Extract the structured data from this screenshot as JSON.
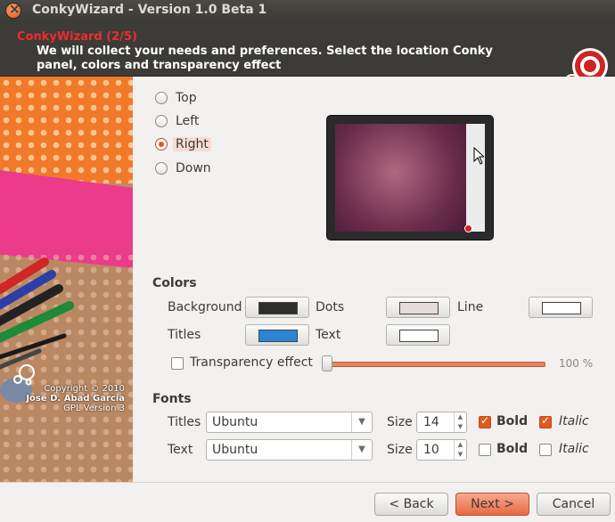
{
  "window": {
    "title": "ConkyWizard - Version 1.0 Beta 1"
  },
  "header": {
    "step": "ConkyWizard (2/5)",
    "description": "We will collect your needs and preferences. Select the location Conky panel, colors and transparency effect"
  },
  "sidebar": {
    "credits": [
      "Copyright © 2010",
      "José D. Abad García",
      "GPL Version 3"
    ]
  },
  "position": {
    "options": [
      "Top",
      "Left",
      "Right",
      "Down"
    ],
    "selected": "Right"
  },
  "colors": {
    "section_label": "Colors",
    "background_label": "Background",
    "background_color": "#2e2e2b",
    "dots_label": "Dots",
    "dots_color": "#e6dcdc",
    "line_label": "Line",
    "line_color": "#ffffff",
    "titles_label": "Titles",
    "titles_color": "#2a86d4",
    "text_label": "Text",
    "text_color": "#ffffff",
    "transparency_label": "Transparency effect",
    "transparency_checked": false,
    "transparency_value": "100 %",
    "transparency_fraction": 1.0
  },
  "fonts": {
    "section_label": "Fonts",
    "titles": {
      "label": "Titles",
      "family": "Ubuntu",
      "size_label": "Size",
      "size": "14",
      "bold_label": "Bold",
      "bold": true,
      "italic_label": "Italic",
      "italic": true
    },
    "text": {
      "label": "Text",
      "family": "Ubuntu",
      "size_label": "Size",
      "size": "10",
      "bold_label": "Bold",
      "bold": false,
      "italic_label": "Italic",
      "italic": false
    }
  },
  "buttons": {
    "back": "< Back",
    "next": "Next >",
    "cancel": "Cancel"
  },
  "accent_color": "#e05a1e"
}
